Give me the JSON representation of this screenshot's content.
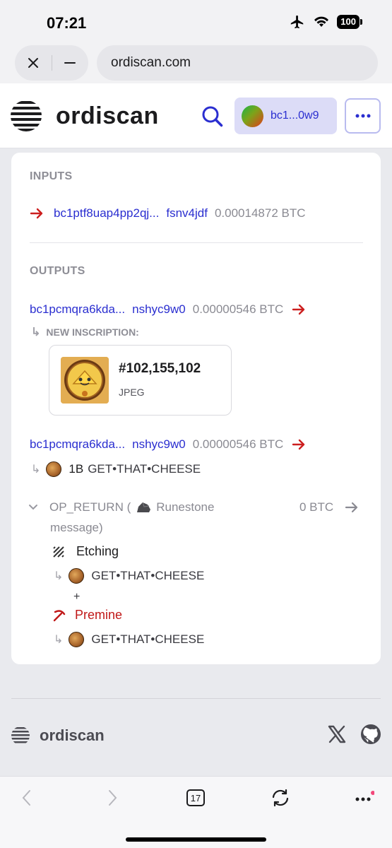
{
  "status_bar": {
    "time": "07:21",
    "battery": "100"
  },
  "browser": {
    "url": "ordiscan.com",
    "tab_count": "17"
  },
  "header": {
    "logo_text": "ordiscan",
    "wallet_address": "bc1...0w9"
  },
  "inputs": {
    "label": "INPUTS",
    "items": [
      {
        "address_start": "bc1ptf8uap4pp2qj...",
        "address_end": "fsnv4jdf",
        "amount": "0.00014872 BTC"
      }
    ]
  },
  "outputs": {
    "label": "OUTPUTS",
    "items": [
      {
        "address_start": "bc1pcmqra6kda...",
        "address_end": "nshyc9w0",
        "amount": "0.00000546 BTC",
        "sub_label": "NEW INSCRIPTION:",
        "inscription": {
          "number": "#102,155,102",
          "type": "JPEG"
        }
      },
      {
        "address_start": "bc1pcmqra6kda...",
        "address_end": "nshyc9w0",
        "amount": "0.00000546 BTC",
        "rune_amount": "1B",
        "rune_name": "GET•THAT•CHEESE"
      }
    ],
    "op_return": {
      "line1": "OP_RETURN (",
      "runestone": "Runestone",
      "line2": "message)",
      "amount": "0 BTC",
      "etching_label": "Etching",
      "etching_rune": "GET•THAT•CHEESE",
      "plus": "+",
      "premine_label": "Premine",
      "premine_rune": "GET•THAT•CHEESE"
    }
  },
  "footer": {
    "logo_text": "ordiscan"
  }
}
